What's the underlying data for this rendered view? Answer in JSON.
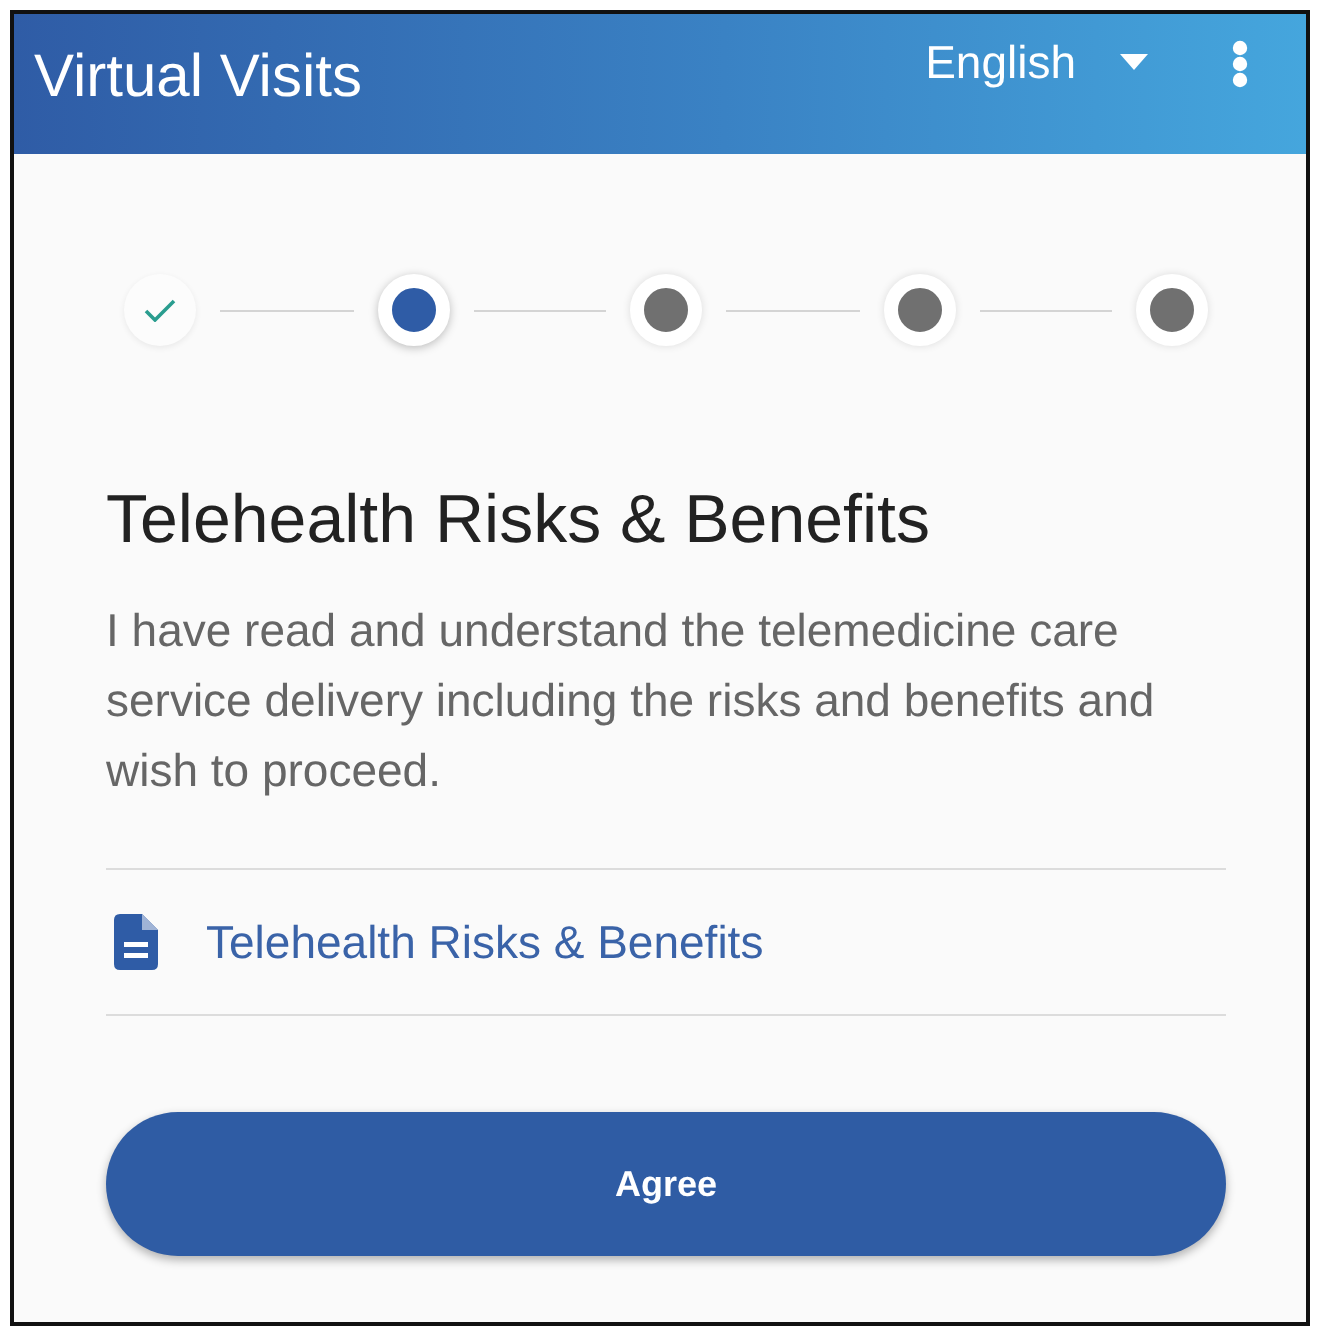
{
  "header": {
    "title": "Virtual Visits",
    "language": {
      "label": "English"
    }
  },
  "stepper": {
    "steps": [
      {
        "completed": true,
        "selected": false
      },
      {
        "completed": false,
        "selected": true
      },
      {
        "completed": false,
        "selected": false
      },
      {
        "completed": false,
        "selected": false
      },
      {
        "completed": false,
        "selected": false
      }
    ]
  },
  "content": {
    "heading": "Telehealth Risks & Benefits",
    "body": "I have read and understand the telemedicine care service delivery including the risks and benefits and wish to proceed.",
    "document_link": "Telehealth Risks & Benefits"
  },
  "buttons": [
    {
      "label": "Agree"
    }
  ]
}
